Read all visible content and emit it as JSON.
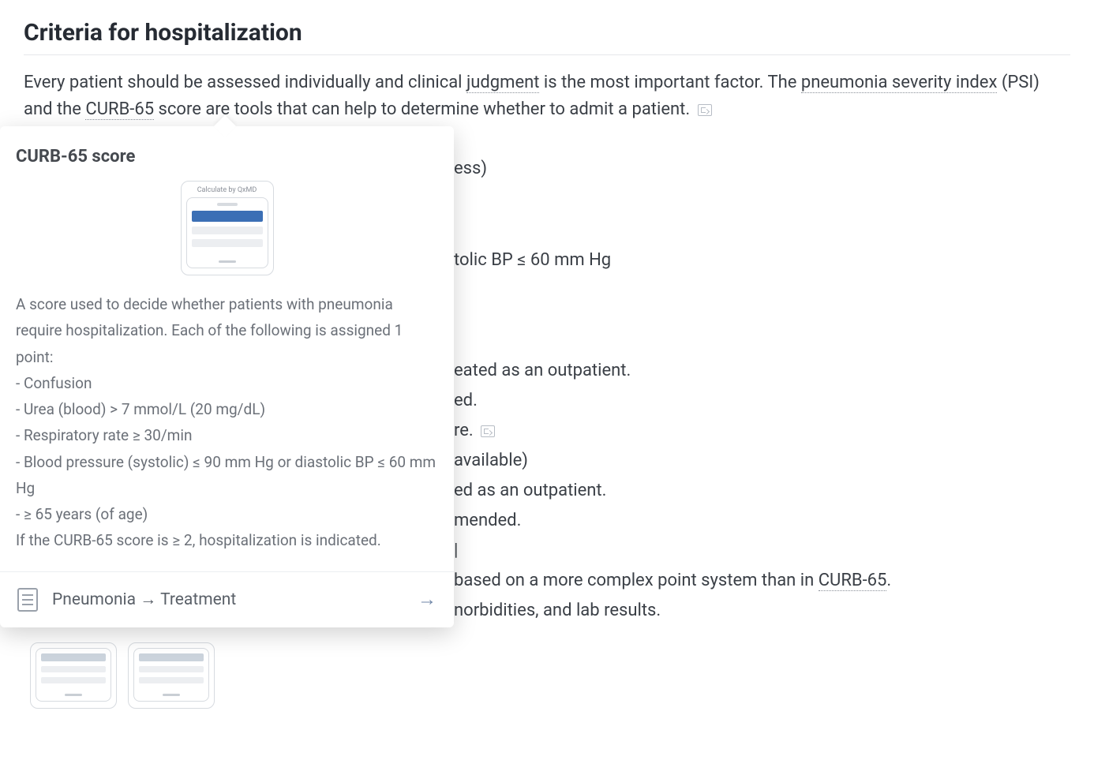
{
  "section": {
    "title": "Criteria for hospitalization",
    "intro_pre": "Every patient should be assessed individually and clinical ",
    "intro_term1": "judgment",
    "intro_mid1": " is the most important factor. The ",
    "intro_term2": "pneumonia severity index",
    "intro_mid2": " (PSI) and the ",
    "intro_term3": "CURB-65",
    "intro_post": " score are tools that can help to determine whether to admit a patient. "
  },
  "bg": {
    "l0": "ess)",
    "l1": "tolic BP ≤ 60 mm Hg",
    "l2": "eated as an outpatient.",
    "l3": "ed.",
    "l4": "re.",
    "l5": "available)",
    "l6": "ed as an outpatient.",
    "l7": "mended.",
    "l8": "|",
    "l9_pre": " based on a more complex point system than in ",
    "l9_term": "CURB-65",
    "l9_post": ".",
    "l10": "norbidities, and lab results."
  },
  "popover": {
    "title": "CURB-65 score",
    "calc_caption": "Calculate by QxMD",
    "desc_intro": "A score used to decide whether patients with pneumonia require hospitalization. Each of the following is assigned 1 point:",
    "criteria": [
      "- Confusion",
      "- Urea (blood) > 7 mmol/L (20 mg/dL)",
      "- Respiratory rate ≥ 30/min",
      "- Blood pressure (systolic) ≤ 90 mm Hg or diastolic BP ≤ 60 mm Hg",
      "- ≥ 65 years (of age)"
    ],
    "desc_outro": "If the CURB-65 score is ≥ 2, hospitalization is indicated.",
    "link_label": "Pneumonia → Treatment"
  }
}
